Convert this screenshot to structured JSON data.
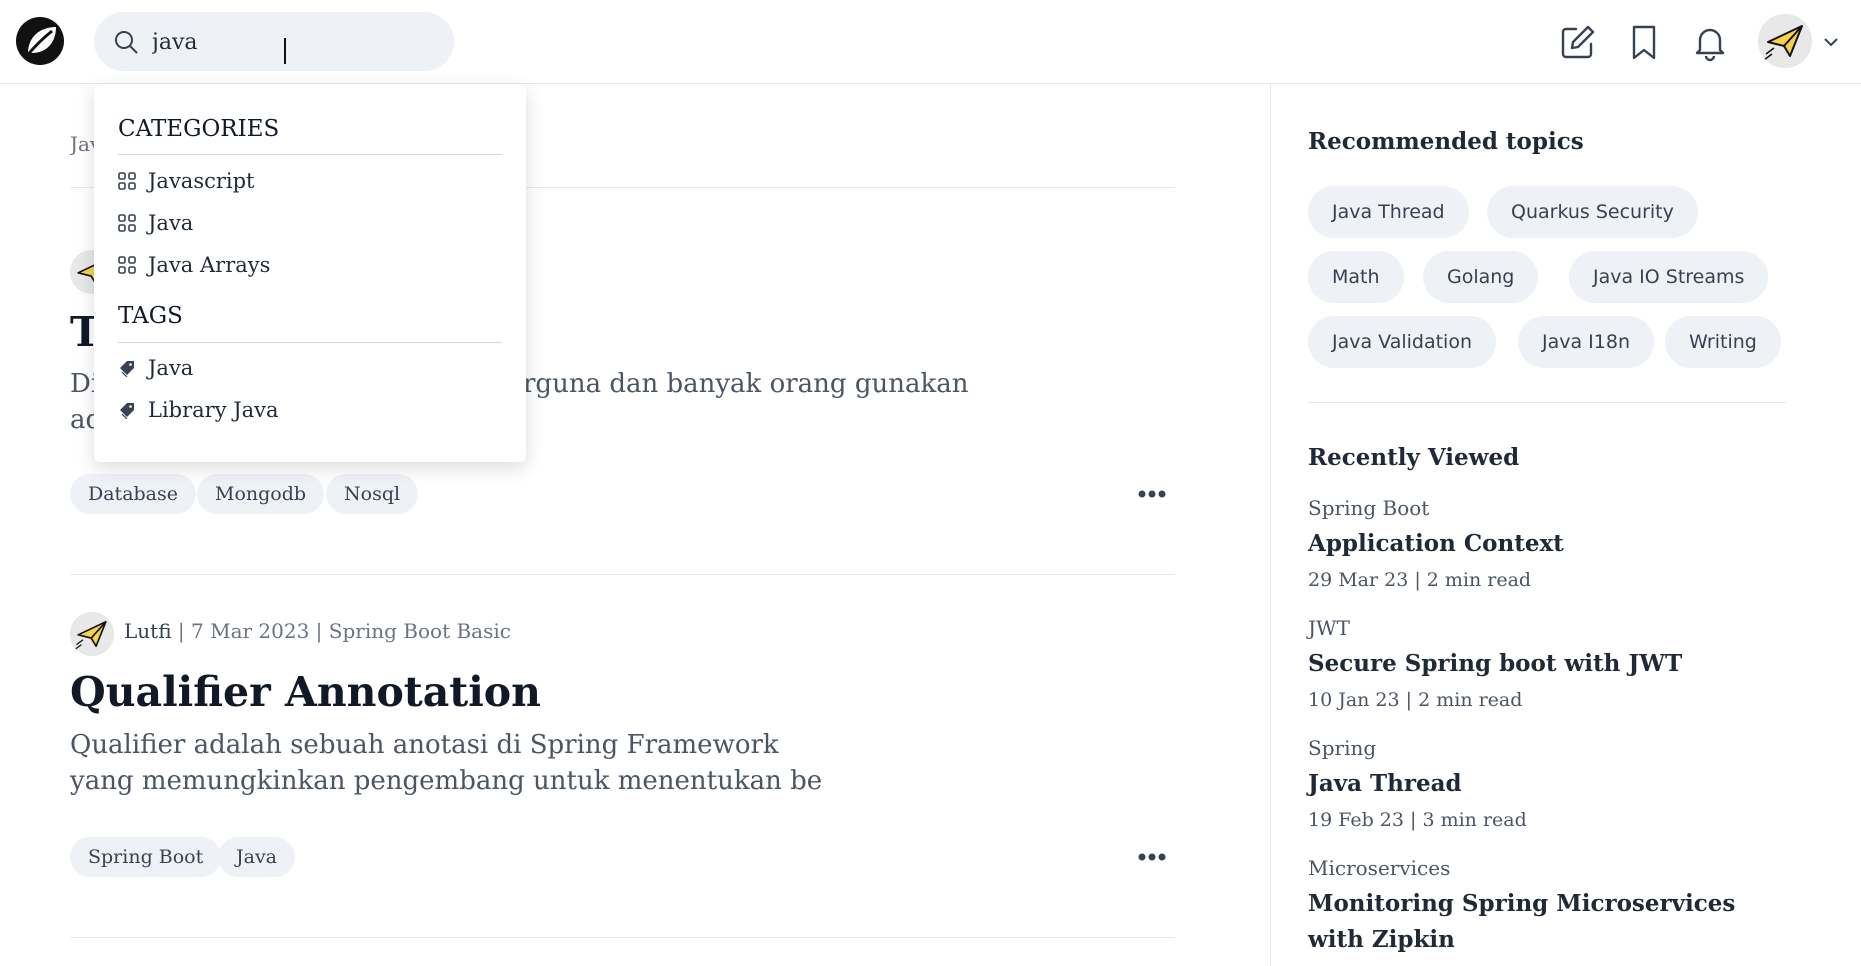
{
  "header": {
    "search_value": "java",
    "logo_icon": "leaf-logo-icon",
    "icons": [
      "write-icon",
      "bookmark-icon",
      "bell-icon"
    ],
    "avatar_icon": "paper-plane-avatar"
  },
  "search_dropdown": {
    "categories_heading": "CATEGORIES",
    "categories": [
      {
        "label": "Javascript",
        "icon": "grid-icon"
      },
      {
        "label": "Java",
        "icon": "grid-icon"
      },
      {
        "label": "Java Arrays",
        "icon": "grid-icon"
      }
    ],
    "tags_heading": "TAGS",
    "tags": [
      {
        "label": "Java",
        "icon": "tag-icon"
      },
      {
        "label": "Library Java",
        "icon": "tag-icon"
      }
    ]
  },
  "feed": {
    "category_strip": "Jav",
    "posts": [
      {
        "title": "T",
        "excerpt_line1": "Di",
        "excerpt_line1_tail": "rguna dan banyak orang gunakan",
        "excerpt_line2": "ad",
        "tags": [
          "Database",
          "Mongodb",
          "Nosql"
        ]
      },
      {
        "author": "Lutfi",
        "date": "| 7 Mar 2023",
        "separator": "|",
        "category": "Spring Boot Basic",
        "title": "Qualifier Annotation",
        "excerpt": "Qualifier adalah sebuah anotasi di Spring Framework yang memungkinkan pengembang untuk menentukan be",
        "tags": [
          "Spring Boot",
          "Java"
        ]
      }
    ]
  },
  "sidebar": {
    "recommended_title": "Recommended topics",
    "topics": [
      "Java Thread",
      "Quarkus Security",
      "Math",
      "Golang",
      "Java IO Streams",
      "Java Validation",
      "Java I18n",
      "Writing"
    ],
    "recent_title": "Recently Viewed",
    "recent": [
      {
        "category": "Spring Boot",
        "title": "Application Context",
        "meta": "29 Mar 23 | 2 min read"
      },
      {
        "category": "JWT",
        "title": "Secure Spring boot with JWT",
        "meta": "10 Jan 23 | 2 min read"
      },
      {
        "category": "Spring",
        "title": "Java Thread",
        "meta": "19 Feb 23 | 3 min read"
      },
      {
        "category": "Microservices",
        "title": "Monitoring Spring Microservices with Zipkin",
        "meta": ""
      }
    ]
  }
}
